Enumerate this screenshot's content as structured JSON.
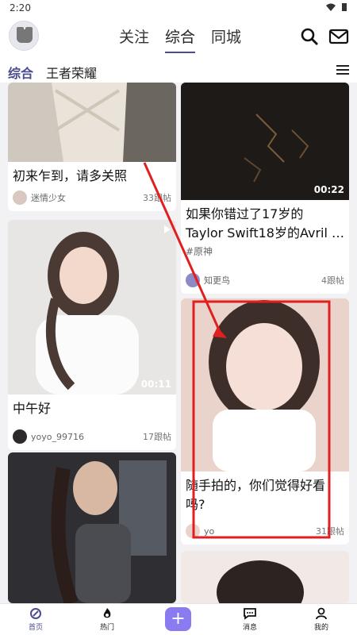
{
  "status": {
    "time": "2:20"
  },
  "header": {
    "tabs": [
      "关注",
      "综合",
      "同城"
    ],
    "active_tab": "综合"
  },
  "subtabs": {
    "items": [
      "综合",
      "王者荣耀"
    ]
  },
  "cards": [
    {
      "title": "初来乍到，请多关照",
      "user": "迷情少女",
      "count": "33跟帖"
    },
    {
      "badge": "00:22",
      "title": "如果你错过了17岁的 Taylor Swift18岁的Avril …",
      "tag": "#原神",
      "user": "知更鸟",
      "count": "4跟帖"
    },
    {
      "badge": "00:11",
      "title": "中午好",
      "user": "yoyo_99716",
      "count": "17跟帖"
    },
    {
      "title": "随手拍的，你们觉得好看吗?",
      "user": "yo",
      "count": "31跟帖"
    }
  ],
  "bottom_nav": {
    "home": "首页",
    "hot": "热门",
    "messages": "消息",
    "me": "我的"
  },
  "colors": {
    "accent": "#4b4b8f",
    "plus": "#8a7bf1",
    "annotation": "#e02020"
  }
}
